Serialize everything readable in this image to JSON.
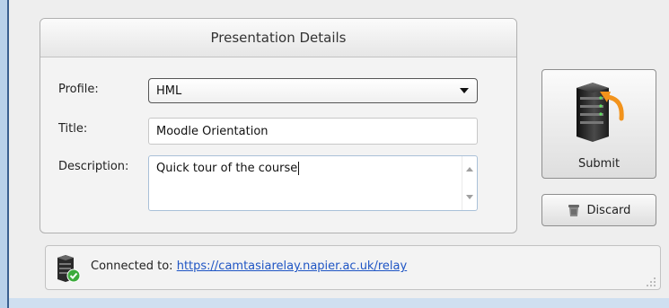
{
  "group": {
    "title": "Presentation Details"
  },
  "form": {
    "profile_label": "Profile:",
    "profile_value": "HML",
    "title_label": "Title:",
    "title_value": "Moodle Orientation",
    "description_label": "Description:",
    "description_value": "Quick tour of the course"
  },
  "actions": {
    "submit_label": "Submit",
    "discard_label": "Discard"
  },
  "status": {
    "prefix": "Connected to: ",
    "url": "https://camtasiarelay.napier.ac.uk/relay"
  },
  "colors": {
    "accent_link": "#1f55c4",
    "window_border": "#3a5f8f",
    "submit_arrow": "#f2931c"
  },
  "icons": {
    "submit": "server-upload-icon",
    "discard": "trash-icon",
    "status": "server-connected-icon"
  }
}
